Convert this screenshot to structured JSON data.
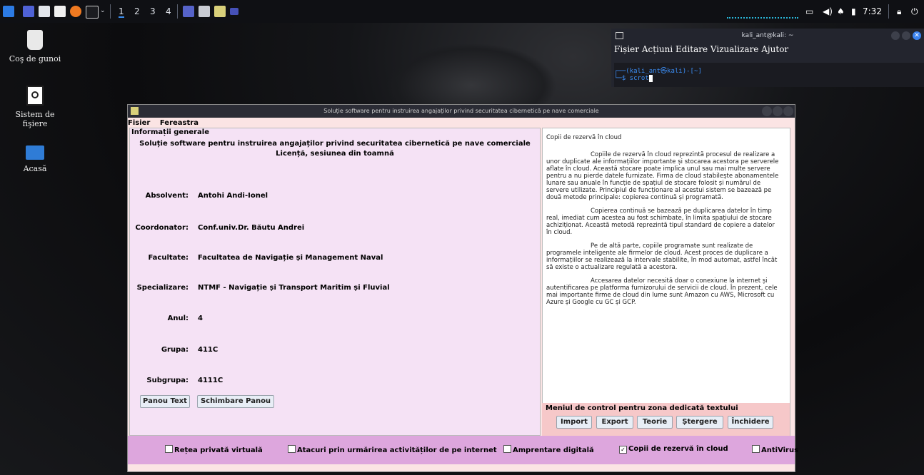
{
  "taskbar": {
    "workspaces": [
      "1",
      "2",
      "3",
      "4"
    ],
    "clock": "7:32"
  },
  "desktop": {
    "icons": [
      {
        "label": "Coş de gunoi"
      },
      {
        "label": "Sistem de fişiere"
      },
      {
        "label": "Acasă"
      }
    ]
  },
  "terminal": {
    "title": "kali_ant@kali: ~",
    "menu": [
      "Fișier",
      "Acțiuni",
      "Editare",
      "Vizualizare",
      "Ajutor"
    ],
    "prompt_line1": "┌──(kali_ant㉿kali)-[~]",
    "prompt_line2": "└─$ scrot"
  },
  "app": {
    "title": "Soluție software pentru instruirea angajaților privind securitatea cibernetică pe nave comerciale",
    "menu": [
      "Fisier",
      "Fereastra"
    ],
    "panel_legend": "Informații generale",
    "heading1": "Soluție software pentru instruirea angajaților privind securitatea cibernetică pe nave comerciale",
    "heading2": "Licență, sesiunea din toamnă",
    "fields": [
      {
        "label": "Absolvent:",
        "value": "Antohi Andi-Ionel"
      },
      {
        "label": "Coordonator:",
        "value": "Conf.univ.Dr. Băutu Andrei"
      },
      {
        "label": "Facultate:",
        "value": "Facultatea de Navigație și Management Naval"
      },
      {
        "label": "Specializare:",
        "value": "NTMF - Navigație și Transport Maritim și Fluvial"
      },
      {
        "label": "Anul:",
        "value": "4"
      },
      {
        "label": "Grupa:",
        "value": "411C"
      },
      {
        "label": "Subgrupa:",
        "value": "4111C"
      }
    ],
    "buttons": {
      "text_panel": "Panou Text",
      "change_panel": "Schimbare Panou"
    },
    "text": {
      "heading": "Copii de rezervă în cloud",
      "paragraphs": [
        "Copiile de rezervă în cloud reprezintă procesul de realizare a unor duplicate ale informațiilor importante și stocarea acestora pe serverele aflate în cloud. Această stocare poate implica unul sau mai multe servere pentru a nu pierde datele furnizate. Firma de cloud stabilește abonamentele lunare sau anuale în funcție de spațiul de stocare folosit și numărul de servere utilizate. Principiul de funcționare al acestui sistem se bazează pe două metode principale: copierea continuă și programată.",
        "Copierea continuă se bazează pe duplicarea datelor în timp real, imediat cum acestea au fost schimbate, în limita spațiului de stocare achiziționat. Această metodă reprezintă tipul standard de copiere a datelor în cloud.",
        "Pe de altă parte, copiile programate sunt realizate de programele inteligente ale firmelor de cloud. Acest proces de duplicare a informațiilor se realizează la intervale stabilite, în mod automat, astfel încât să existe o actualizare regulată a acestora.",
        "Accesarea datelor necesită doar o conexiune la internet și autentificarea pe platforma furnizorului de servicii de cloud. În prezent, cele mai importante firme de cloud din lume sunt Amazon cu AWS, Microsoft cu Azure și Google cu GC și GCP."
      ]
    },
    "control": {
      "label": "Meniul de control pentru zona dedicată textului",
      "buttons": [
        "Import",
        "Export",
        "Teorie",
        "Ștergere",
        "Închidere"
      ]
    },
    "checkboxes": [
      {
        "label": "Rețea privată virtuală",
        "checked": false
      },
      {
        "label": "Atacuri prin urmărirea activităților de pe internet",
        "checked": false
      },
      {
        "label": "Amprentare digitală",
        "checked": false
      },
      {
        "label": "Copii de rezervă în cloud",
        "checked": true
      },
      {
        "label": "AntiVirus",
        "checked": false
      }
    ]
  }
}
